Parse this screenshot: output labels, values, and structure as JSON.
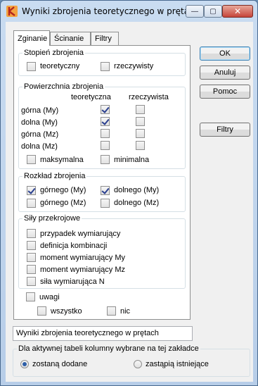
{
  "window": {
    "title": "Wyniki zbrojenia teoretycznego w prętach",
    "minimize_glyph": "—",
    "maximize_glyph": "▢",
    "close_glyph": "✕",
    "accent": "#c6453a"
  },
  "tabs": [
    {
      "label": "Zginanie",
      "active": true
    },
    {
      "label": "Ścinanie",
      "active": false
    },
    {
      "label": "Filtry",
      "active": false
    }
  ],
  "stopien": {
    "title": "Stopień zbrojenia",
    "teoretyczny": {
      "label": "teoretyczny",
      "checked": false
    },
    "rzeczywisty": {
      "label": "rzeczywisty",
      "checked": false
    }
  },
  "powierzchnia": {
    "title": "Powierzchnia zbrojenia",
    "col_teoretyczna": "teoretyczna",
    "col_rzeczywista": "rzeczywista",
    "rows": [
      {
        "label": "górna (My)",
        "teoretyczna": true,
        "rzeczywista": false
      },
      {
        "label": "dolna (My)",
        "teoretyczna": true,
        "rzeczywista": false
      },
      {
        "label": "górna (Mz)",
        "teoretyczna": false,
        "rzeczywista": false
      },
      {
        "label": "dolna (Mz)",
        "teoretyczna": false,
        "rzeczywista": false
      }
    ],
    "maksymalna": {
      "label": "maksymalna",
      "checked": false
    },
    "minimalna": {
      "label": "minimalna",
      "checked": false
    }
  },
  "rozklad": {
    "title": "Rozkład zbrojenia",
    "gornego_my": {
      "label": "górnego (My)",
      "checked": true
    },
    "dolnego_my": {
      "label": "dolnego (My)",
      "checked": true
    },
    "gornego_mz": {
      "label": "górnego (Mz)",
      "checked": false
    },
    "dolnego_mz": {
      "label": "dolnego (Mz)",
      "checked": false
    }
  },
  "sily": {
    "title": "Siły przekrojowe",
    "items": [
      {
        "label": "przypadek wymiarujący",
        "checked": false
      },
      {
        "label": "definicja kombinacji",
        "checked": false
      },
      {
        "label": "moment wymiarujący My",
        "checked": false
      },
      {
        "label": "moment wymiarujący Mz",
        "checked": false
      },
      {
        "label": "siła wymiarująca N",
        "checked": false
      }
    ]
  },
  "uwagi": {
    "label": "uwagi",
    "checked": false
  },
  "wszystko": {
    "label": "wszystko",
    "checked": false
  },
  "nic": {
    "label": "nic",
    "checked": false
  },
  "buttons": {
    "ok": "OK",
    "anuluj": "Anuluj",
    "pomoc": "Pomoc",
    "filtry": "Filtry"
  },
  "table_name": "Wyniki zbrojenia teoretycznego w prętach",
  "columns_group": {
    "title": "Dla aktywnej tabeli kolumny wybrane na tej zakładce",
    "dodane": {
      "label": "zostaną dodane",
      "selected": true
    },
    "zastapia": {
      "label": "zastąpią istniejące",
      "selected": false
    }
  }
}
